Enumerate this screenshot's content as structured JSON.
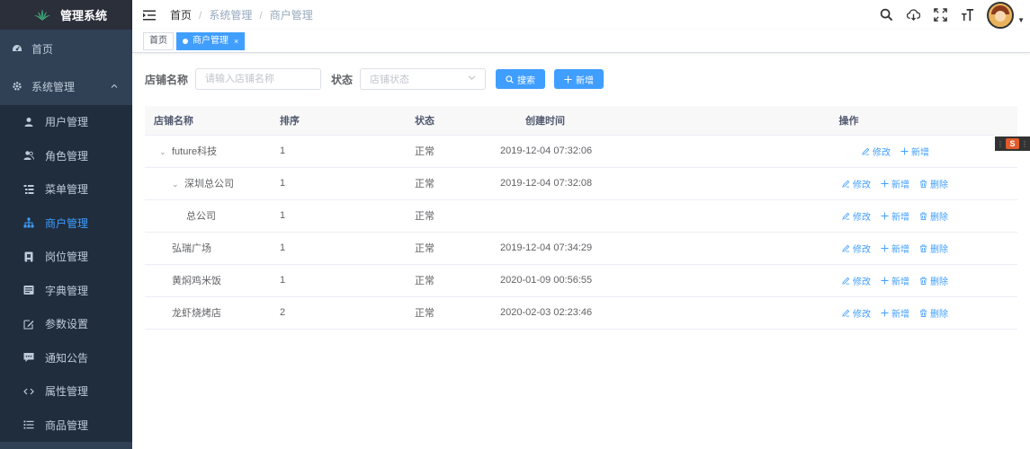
{
  "app": {
    "title": "管理系统"
  },
  "sidebar": {
    "items": [
      {
        "label": "首页",
        "icon": "dashboard-icon"
      },
      {
        "label": "系统管理",
        "icon": "gear-icon"
      },
      {
        "label": "用户管理",
        "icon": "user-icon"
      },
      {
        "label": "角色管理",
        "icon": "peoples-icon"
      },
      {
        "label": "菜单管理",
        "icon": "tree-table-icon"
      },
      {
        "label": "商户管理",
        "icon": "tree-icon"
      },
      {
        "label": "岗位管理",
        "icon": "post-icon"
      },
      {
        "label": "字典管理",
        "icon": "dict-icon"
      },
      {
        "label": "参数设置",
        "icon": "edit-icon"
      },
      {
        "label": "通知公告",
        "icon": "message-icon"
      },
      {
        "label": "属性管理",
        "icon": "code-icon"
      },
      {
        "label": "商品管理",
        "icon": "list-icon"
      }
    ],
    "active_color": "#409eff"
  },
  "breadcrumb": [
    "首页",
    "系统管理",
    "商户管理"
  ],
  "tags": [
    {
      "label": "首页"
    },
    {
      "label": "商户管理",
      "close": "×"
    }
  ],
  "search": {
    "name_label": "店铺名称",
    "name_placeholder": "请输入店铺名称",
    "status_label": "状态",
    "status_placeholder": "店铺状态",
    "search_button": "搜索",
    "add_button": "新增"
  },
  "table": {
    "columns": [
      "店铺名称",
      "排序",
      "状态",
      "创建时间",
      "操作"
    ],
    "rows": [
      {
        "name": "future科技",
        "sort": "1",
        "status": "正常",
        "time": "2019-12-04 07:32:06",
        "level": 0,
        "expand": "⌄",
        "ops": [
          "修改",
          "新增"
        ]
      },
      {
        "name": "深圳总公司",
        "sort": "1",
        "status": "正常",
        "time": "2019-12-04 07:32:08",
        "level": 1,
        "expand": "⌄",
        "ops": [
          "修改",
          "新增",
          "删除"
        ]
      },
      {
        "name": "总公司",
        "sort": "1",
        "status": "正常",
        "time": "",
        "level": 2,
        "expand": "",
        "ops": [
          "修改",
          "新增",
          "删除"
        ]
      },
      {
        "name": "弘瑞广场",
        "sort": "1",
        "status": "正常",
        "time": "2019-12-04 07:34:29",
        "level": 1,
        "expand": "",
        "ops": [
          "修改",
          "新增",
          "删除"
        ]
      },
      {
        "name": "黄焖鸡米饭",
        "sort": "1",
        "status": "正常",
        "time": "2020-01-09 00:56:55",
        "level": 1,
        "expand": "",
        "ops": [
          "修改",
          "新增",
          "删除"
        ]
      },
      {
        "name": "龙虾烧烤店",
        "sort": "2",
        "status": "正常",
        "time": "2020-02-03 02:23:46",
        "level": 1,
        "expand": "",
        "ops": [
          "修改",
          "新增",
          "删除"
        ]
      }
    ]
  },
  "float_widget": {
    "label": "S"
  }
}
